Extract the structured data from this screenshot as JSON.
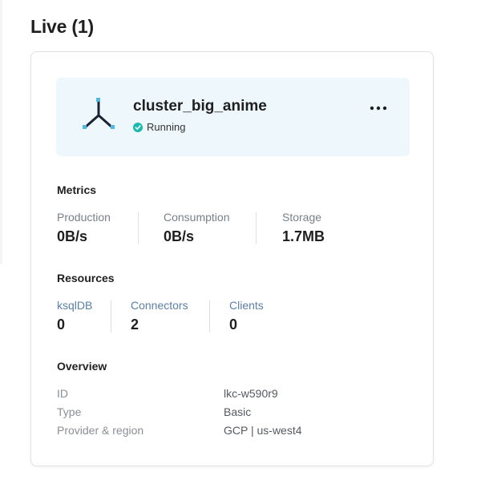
{
  "section": {
    "title": "Live (1)"
  },
  "cluster": {
    "name": "cluster_big_anime",
    "status": "Running",
    "icon": "cluster-icon",
    "menu_icon": "more-options-icon"
  },
  "metrics": {
    "title": "Metrics",
    "items": [
      {
        "label": "Production",
        "value": "0B/s"
      },
      {
        "label": "Consumption",
        "value": "0B/s"
      },
      {
        "label": "Storage",
        "value": "1.7MB"
      }
    ]
  },
  "resources": {
    "title": "Resources",
    "items": [
      {
        "label": "ksqlDB",
        "value": "0"
      },
      {
        "label": "Connectors",
        "value": "2"
      },
      {
        "label": "Clients",
        "value": "0"
      }
    ]
  },
  "overview": {
    "title": "Overview",
    "rows": [
      {
        "key": "ID",
        "value": "lkc-w590r9"
      },
      {
        "key": "Type",
        "value": "Basic"
      },
      {
        "key": "Provider & region",
        "value": "GCP | us-west4"
      }
    ]
  },
  "colors": {
    "accent_teal": "#1bb8b0",
    "header_bg": "#eef8fc",
    "icon_dark": "#1a2233",
    "icon_handle": "#4fb9e3"
  }
}
